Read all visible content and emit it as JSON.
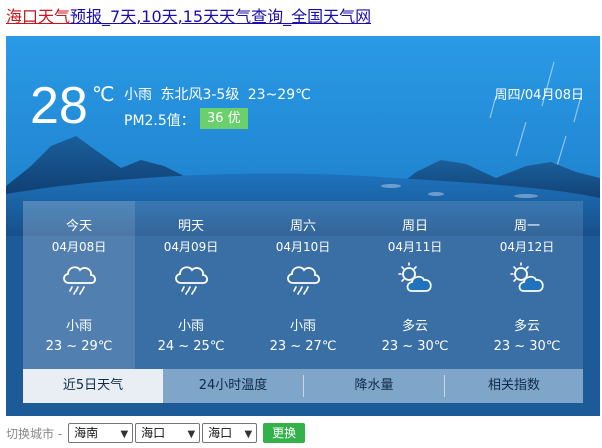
{
  "title": {
    "part1": "海口天气",
    "part2": "预报_7天,10天,15天天气查询_全国天气网"
  },
  "current": {
    "temp": "28",
    "unit": "℃",
    "desc": "小雨 东北风3-5级 23~29℃",
    "pm_label": "PM2.5值：",
    "pm_value": "36 优",
    "date": "周四/04月08日"
  },
  "forecast": [
    {
      "day": "今天",
      "date": "04月08日",
      "icon": "rain-cloud-icon",
      "weather": "小雨",
      "temp": "23 ~ 29℃"
    },
    {
      "day": "明天",
      "date": "04月09日",
      "icon": "rain-cloud-icon",
      "weather": "小雨",
      "temp": "24 ~ 25℃"
    },
    {
      "day": "周六",
      "date": "04月10日",
      "icon": "rain-cloud-icon",
      "weather": "小雨",
      "temp": "23 ~ 27℃"
    },
    {
      "day": "周日",
      "date": "04月11日",
      "icon": "partly-cloudy-icon",
      "weather": "多云",
      "temp": "23 ~ 30℃"
    },
    {
      "day": "周一",
      "date": "04月12日",
      "icon": "partly-cloudy-icon",
      "weather": "多云",
      "temp": "23 ~ 30℃"
    }
  ],
  "tabs": [
    "近5日天气",
    "24小时温度",
    "降水量",
    "相关指数"
  ],
  "switcher": {
    "label": "切换城市 -",
    "province": "海南",
    "city": "海口",
    "district": "海口",
    "button": "更换"
  },
  "colors": {
    "pm_good": "#6ccf6e",
    "switch_button": "#33b24a",
    "title_red": "#c4161c",
    "title_link": "#1a0dab"
  }
}
